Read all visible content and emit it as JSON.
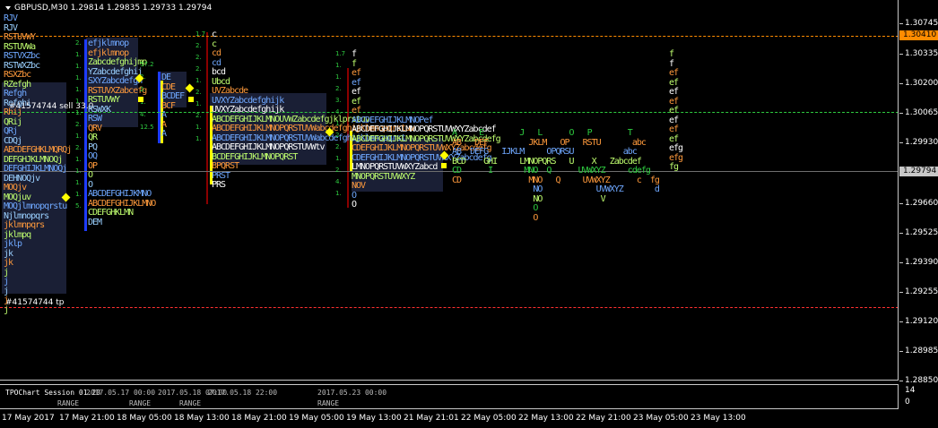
{
  "window": {
    "symbol_title": "GBPUSD,M30  1.29814 1.29835 1.29733 1.29794"
  },
  "price_scale": [
    {
      "label": "1.30745"
    },
    {
      "label": "1.30335"
    },
    {
      "label": "1.30200"
    },
    {
      "label": "1.30065"
    },
    {
      "label": "1.29930"
    },
    {
      "label": "1.29660"
    },
    {
      "label": "1.29525"
    },
    {
      "label": "1.29390"
    },
    {
      "label": "1.29255"
    },
    {
      "label": "1.29120"
    },
    {
      "label": "1.28985"
    },
    {
      "label": "1.28850"
    }
  ],
  "price_tags": {
    "order_level": "1.30410",
    "current_price": "1.29794"
  },
  "order_labels": {
    "sell": "#41574744 sell 33.0",
    "tp": "#41574744 tp"
  },
  "time_axis": [
    "17 May 2017",
    "17 May 21:00",
    "18 May 05:00",
    "18 May 13:00",
    "18 May 21:00",
    "19 May 05:00",
    "19 May 13:00",
    "21 May 21:01",
    "22 May 05:00",
    "22 May 13:00",
    "22 May 21:00",
    "23 May 05:00",
    "23 May 13:00"
  ],
  "indicator": {
    "name": "TPOChart Session 01.20",
    "scale_top": "14",
    "scale_bottom": "0",
    "labels": [
      "2017.05.17 00:00",
      "2017.05.18 07:00",
      "2017.05.18 22:00",
      "2017.05.23 00:00"
    ],
    "range_label": "RANGE"
  },
  "profiles": {
    "p1": [
      "RJV",
      "RJV",
      "RSTUVWY",
      "RSTUVWa",
      "RSTVXZbc",
      "RSTWXZbc",
      "RSXZbc",
      "RZefgh",
      "Refgh",
      "Refghi",
      "Rhij",
      "QRij",
      "QRj",
      "CDQj",
      "ABCDEFGHKLMQRQj",
      "DEFGHJKLMNOQj",
      "DEFGHIJKLMNOQj",
      "DEHNOQjv",
      "MOQjv",
      "MOQjuv",
      "MOQjlmnopqrstu",
      "Njlmnopqrs",
      "jklmnpqrs",
      "jklmpq",
      "jklp",
      "jk",
      "jk",
      "j",
      "j",
      "j",
      "j",
      "j"
    ],
    "p2": [
      "efjklmnop",
      "efjklmnop",
      "Zabcdefghijmp",
      "YZabcdefghij",
      "SXYZabcdefgh",
      "RSTUVXZabcefg",
      "RSTUVWY",
      "RSWXK",
      "RSW",
      "QRV",
      "QR",
      "PQ",
      "OQ",
      "OP",
      "O",
      "O",
      "ABCDEFGHIJKMNO",
      "ABCDEFGHIJKLMNO",
      "CDEFGHKLMN",
      "DEM"
    ],
    "p3": [
      "DE",
      "CDE",
      "BCDEF",
      "BCF",
      "A",
      "A",
      "A"
    ],
    "p4": [
      "c",
      "c",
      "cd",
      "cd",
      "bcd",
      "Ubcd",
      "UVZabcde",
      "UVXYZabcdefghijk",
      "UVXYZabcdefghijk",
      "ABCDEFGHIJKLMNOUVWZabcdefgjklprstuv",
      "ABCDEFGHIJKLMNOPQRSTUVWabcdefghijklmnopqrstuv",
      "ABCDEFGHIJKLMNOPQRSTUVWabcdefghijklmnopqrst",
      "ABCDEFGHIJKLMNOPQRSTUVWtv",
      "BCDEFGHIJKLMNOPQRST",
      "BPQRST",
      "PRST",
      "PRS"
    ],
    "p5": [
      "f",
      "f",
      "ef",
      "ef",
      "ef",
      "ef",
      "ef",
      "ABCDEFGHIJKLMNOPef",
      "ABCDEFGHIJKLMNOPQRSTUVWXYZabcdef",
      "ABCDEFGHIJKLMNOPQRSTUVWXYZabcdefg",
      "CDEFGHIJKLMNOPQRSTUVWXYZabcdefg",
      "CDEFGHIJKLMNOPQRSTUVWXYZabcdefg",
      "LMNOPQRSTUVWXYZabcd",
      "MNOPQRSTUVWXYZ",
      "NOV",
      "O",
      "O"
    ],
    "p6": [
      "A     E        J   L      O   P        T",
      "AB   DEF         JKLM   OP   RSTU       abc",
      "AB  DEFG   IJKLM     OPQRSU           abc",
      "BCD    GHI     LMNOPQRS   U    X   Zabcdef",
      "CD      I       MNO  Q      UVWXYZ     cdefg",
      "CD               MNO   Q     UVWXYZ      c  fg",
      "                  NO            UVWXYZ       d",
      "                  NO             V",
      "                  O",
      "                  O"
    ],
    "p7": [
      "f",
      "f",
      "ef",
      "ef",
      "ef",
      "ef",
      "ef",
      "ef",
      "ef",
      "ef",
      "efg",
      "efg",
      "fg"
    ]
  },
  "tpo_numbers": {
    "n1": [
      "2.",
      "1.",
      "1.",
      "1.",
      "1.",
      "1.",
      "1.",
      "2.",
      "1.",
      "2.",
      "1.",
      "1.",
      "1.",
      "1.",
      "5."
    ],
    "n2": [
      "57.2",
      "2.",
      "2.",
      "1.",
      "4.",
      "12.5"
    ],
    "n3": [
      "1.7",
      "2.",
      "2.",
      "2.",
      "1.",
      "2.",
      "1.",
      "2.",
      "1.",
      "1."
    ],
    "n4": [
      "1.7",
      "1.",
      "1.",
      "2.",
      "3.",
      "4.",
      "1.",
      "2.",
      "2.",
      "1.",
      "2.",
      "4.",
      "1."
    ]
  },
  "colors": {
    "background": "#000000",
    "order_level": "#ff8c00",
    "tp_level": "#ff3030",
    "green_level": "#2ecc40",
    "current_price": "#c8c8c8",
    "va_box": "#1a1f35",
    "poc_yellow": "#ffff00"
  }
}
